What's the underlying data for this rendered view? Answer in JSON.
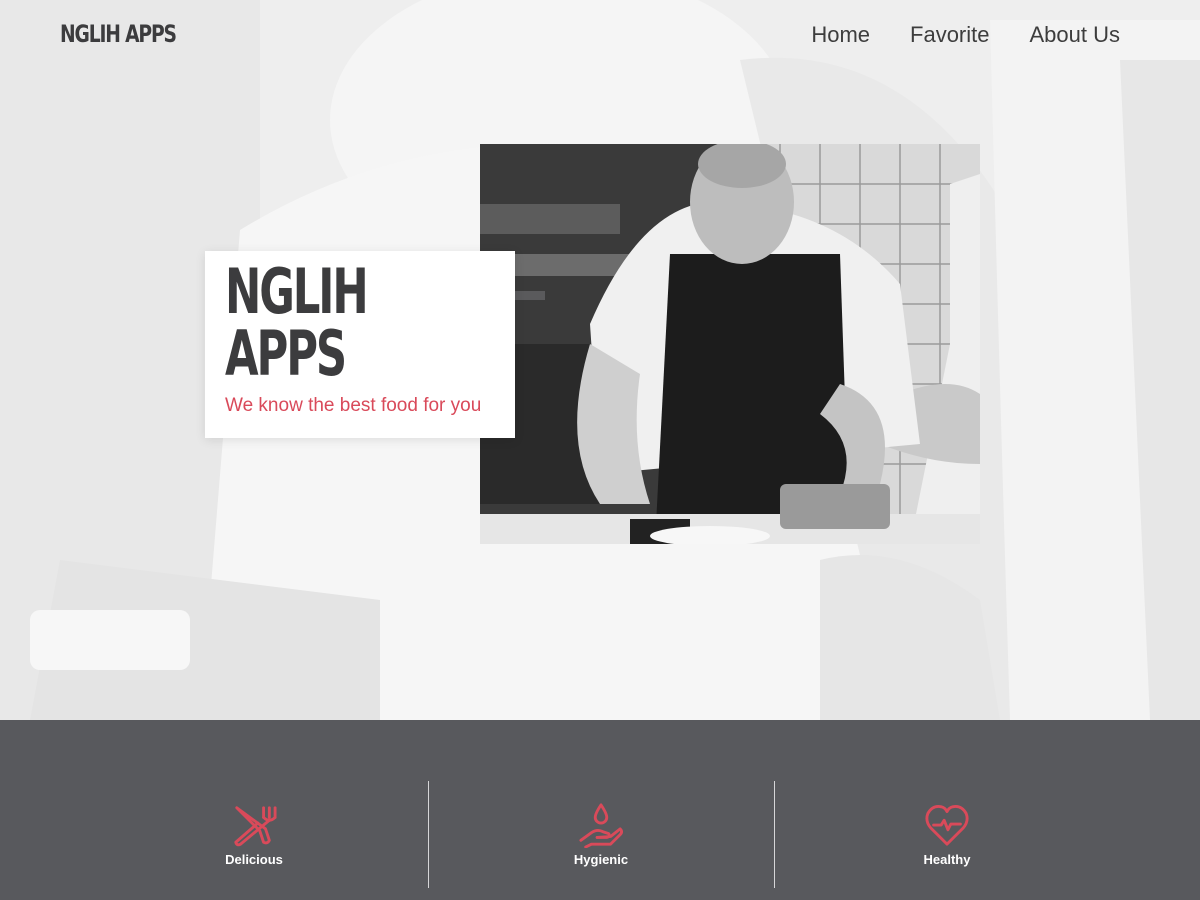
{
  "brand": "NGLIH APPS",
  "nav": {
    "items": [
      {
        "label": "Home"
      },
      {
        "label": "Favorite"
      },
      {
        "label": "About Us"
      }
    ]
  },
  "hero": {
    "title_line1": "NGLIH",
    "title_line2": "APPS",
    "tagline": "We know the best food for you"
  },
  "features": {
    "items": [
      {
        "label": "Delicious",
        "icon": "fork-knife-icon"
      },
      {
        "label": "Hygienic",
        "icon": "hand-water-drop-icon"
      },
      {
        "label": "Healthy",
        "icon": "heart-pulse-icon"
      }
    ]
  },
  "colors": {
    "accent": "#d94a5a",
    "dark_text": "#3c3c3e",
    "footer_bg": "#58595d"
  }
}
